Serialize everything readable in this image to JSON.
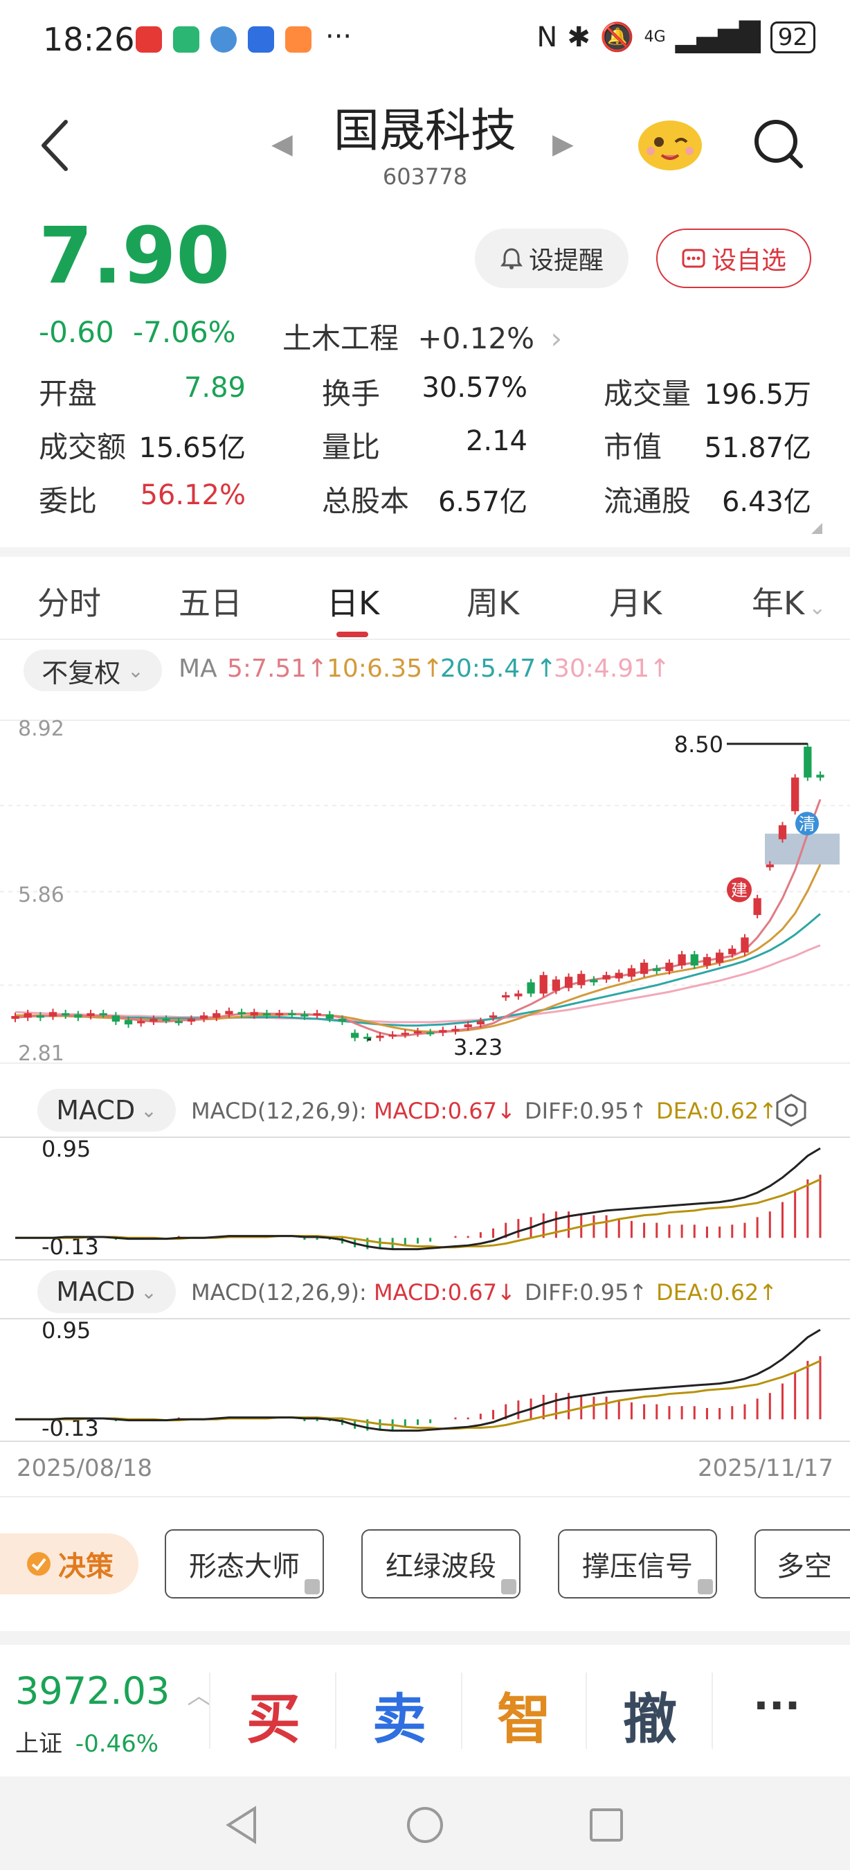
{
  "status_bar": {
    "time": "18:26",
    "network": "4G",
    "battery": "92",
    "icons": [
      "mail-icon",
      "home-icon",
      "weather-icon",
      "app-icon",
      "app-icon-2",
      "bluetooth-icon",
      "mute-icon",
      "signal-icon"
    ]
  },
  "header": {
    "stock_name": "国晟科技",
    "stock_code": "603778"
  },
  "quote": {
    "price": "7.90",
    "change": "-0.60",
    "change_pct": "-7.06%",
    "sector_name": "土木工程",
    "sector_change": "+0.12%",
    "remind_label": "设提醒",
    "favorite_label": "设自选",
    "stats": [
      {
        "label": "开盘",
        "value": "7.89",
        "value_color": "#1aa356"
      },
      {
        "label": "换手",
        "value": "30.57%",
        "value_color": "#222222"
      },
      {
        "label": "成交量",
        "value": "196.5万",
        "value_color": "#222222"
      },
      {
        "label": "成交额",
        "value": "15.65亿",
        "value_color": "#222222"
      },
      {
        "label": "量比",
        "value": "2.14",
        "value_color": "#222222"
      },
      {
        "label": "市值",
        "value": "51.87亿",
        "value_color": "#222222"
      },
      {
        "label": "委比",
        "value": "56.12%",
        "value_color": "#d9363e"
      },
      {
        "label": "总股本",
        "value": "6.57亿",
        "value_color": "#222222"
      },
      {
        "label": "流通股",
        "value": "6.43亿",
        "value_color": "#222222"
      }
    ]
  },
  "tabs": [
    "分时",
    "五日",
    "日K",
    "周K",
    "月K",
    "年K"
  ],
  "active_tab": "日K",
  "kline": {
    "adjust_label": "不复权",
    "ma_label": "MA",
    "ma5": "5:7.51↑",
    "ma10": "10:6.35↑",
    "ma20": "20:5.47↑",
    "ma30": "30:4.91↑",
    "y_top": "8.92",
    "y_mid": "5.86",
    "y_bottom": "2.81",
    "high_label": "8.50",
    "low_label": "3.23",
    "badge_jian": "建",
    "badge_qing": "清"
  },
  "macd_panels": [
    {
      "chip": "MACD",
      "params": "MACD(12,26,9):",
      "macd": "MACD:0.67↓",
      "diff": "DIFF:0.95↑",
      "dea": "DEA:0.62↑",
      "y_top": "0.95",
      "y_bottom": "-0.13"
    },
    {
      "chip": "MACD",
      "params": "MACD(12,26,9):",
      "macd": "MACD:0.67↓",
      "diff": "DIFF:0.95↑",
      "dea": "DEA:0.62↑",
      "y_top": "0.95",
      "y_bottom": "-0.13"
    }
  ],
  "dates": {
    "start": "2025/08/18",
    "end": "2025/11/17"
  },
  "tools": {
    "juece": "决策",
    "items": [
      "形态大师",
      "红绿波段",
      "撑压信号",
      "多空"
    ]
  },
  "bottom_bar": {
    "index_value": "3972.03",
    "index_name": "上证",
    "index_change": "-0.46%",
    "buy": "买",
    "sell": "卖",
    "smart": "智",
    "cancel": "撤",
    "more": "···"
  },
  "colors": {
    "up": "#d9363e",
    "down": "#1aa356",
    "ma5": "#e07b83",
    "ma10": "#d39a3a",
    "ma20": "#2ea6a6",
    "ma30": "#f2a8b8"
  },
  "chart_data": {
    "type": "candlestick",
    "title": "",
    "x_start": "2025/08/18",
    "x_end": "2025/11/17",
    "ylim": [
      2.81,
      8.92
    ],
    "candles": [
      {
        "o": 3.6,
        "c": 3.65
      },
      {
        "o": 3.62,
        "c": 3.7
      },
      {
        "o": 3.66,
        "c": 3.62
      },
      {
        "o": 3.64,
        "c": 3.72
      },
      {
        "o": 3.7,
        "c": 3.66
      },
      {
        "o": 3.68,
        "c": 3.62
      },
      {
        "o": 3.65,
        "c": 3.7
      },
      {
        "o": 3.7,
        "c": 3.68
      },
      {
        "o": 3.66,
        "c": 3.55
      },
      {
        "o": 3.58,
        "c": 3.5
      },
      {
        "o": 3.52,
        "c": 3.56
      },
      {
        "o": 3.55,
        "c": 3.6
      },
      {
        "o": 3.6,
        "c": 3.58
      },
      {
        "o": 3.56,
        "c": 3.54
      },
      {
        "o": 3.55,
        "c": 3.6
      },
      {
        "o": 3.6,
        "c": 3.66
      },
      {
        "o": 3.62,
        "c": 3.7
      },
      {
        "o": 3.68,
        "c": 3.74
      },
      {
        "o": 3.72,
        "c": 3.68
      },
      {
        "o": 3.66,
        "c": 3.72
      },
      {
        "o": 3.7,
        "c": 3.66
      },
      {
        "o": 3.68,
        "c": 3.7
      },
      {
        "o": 3.7,
        "c": 3.68
      },
      {
        "o": 3.68,
        "c": 3.64
      },
      {
        "o": 3.66,
        "c": 3.7
      },
      {
        "o": 3.68,
        "c": 3.6
      },
      {
        "o": 3.6,
        "c": 3.55
      },
      {
        "o": 3.35,
        "c": 3.26
      },
      {
        "o": 3.28,
        "c": 3.25
      },
      {
        "o": 3.26,
        "c": 3.3
      },
      {
        "o": 3.3,
        "c": 3.32
      },
      {
        "o": 3.32,
        "c": 3.35
      },
      {
        "o": 3.34,
        "c": 3.38
      },
      {
        "o": 3.36,
        "c": 3.35
      },
      {
        "o": 3.35,
        "c": 3.4
      },
      {
        "o": 3.38,
        "c": 3.42
      },
      {
        "o": 3.45,
        "c": 3.5
      },
      {
        "o": 3.5,
        "c": 3.56
      },
      {
        "o": 3.62,
        "c": 3.66
      },
      {
        "o": 3.98,
        "c": 4.02
      },
      {
        "o": 4.0,
        "c": 4.05
      },
      {
        "o": 4.25,
        "c": 4.05
      },
      {
        "o": 4.05,
        "c": 4.38
      },
      {
        "o": 4.1,
        "c": 4.3
      },
      {
        "o": 4.15,
        "c": 4.35
      },
      {
        "o": 4.2,
        "c": 4.4
      },
      {
        "o": 4.3,
        "c": 4.25
      },
      {
        "o": 4.3,
        "c": 4.38
      },
      {
        "o": 4.32,
        "c": 4.42
      },
      {
        "o": 4.35,
        "c": 4.5
      },
      {
        "o": 4.4,
        "c": 4.6
      },
      {
        "o": 4.5,
        "c": 4.45
      },
      {
        "o": 4.45,
        "c": 4.6
      },
      {
        "o": 4.55,
        "c": 4.75
      },
      {
        "o": 4.75,
        "c": 4.55
      },
      {
        "o": 4.55,
        "c": 4.7
      },
      {
        "o": 4.6,
        "c": 4.78
      },
      {
        "o": 4.75,
        "c": 4.85
      },
      {
        "o": 4.78,
        "c": 5.05
      },
      {
        "o": 5.45,
        "c": 5.75
      },
      {
        "o": 6.3,
        "c": 6.35
      },
      {
        "o": 6.8,
        "c": 7.05
      },
      {
        "o": 7.3,
        "c": 7.9
      },
      {
        "o": 8.45,
        "c": 7.9
      },
      {
        "o": 7.95,
        "c": 7.9
      }
    ],
    "ma5": [
      3.62,
      3.64,
      3.65,
      3.66,
      3.66,
      3.66,
      3.65,
      3.66,
      3.64,
      3.6,
      3.57,
      3.55,
      3.55,
      3.57,
      3.58,
      3.6,
      3.63,
      3.66,
      3.69,
      3.7,
      3.69,
      3.69,
      3.69,
      3.68,
      3.67,
      3.66,
      3.62,
      3.52,
      3.43,
      3.35,
      3.3,
      3.3,
      3.33,
      3.35,
      3.37,
      3.39,
      3.42,
      3.46,
      3.52,
      3.64,
      3.76,
      3.86,
      3.98,
      4.1,
      4.2,
      4.26,
      4.3,
      4.33,
      4.36,
      4.4,
      4.45,
      4.49,
      4.52,
      4.57,
      4.6,
      4.64,
      4.68,
      4.72,
      4.82,
      5.05,
      5.35,
      5.75,
      6.25,
      6.9,
      7.51
    ],
    "ma10": [
      3.66,
      3.66,
      3.66,
      3.65,
      3.65,
      3.64,
      3.63,
      3.62,
      3.61,
      3.6,
      3.59,
      3.58,
      3.58,
      3.58,
      3.58,
      3.59,
      3.6,
      3.62,
      3.64,
      3.66,
      3.67,
      3.67,
      3.68,
      3.68,
      3.67,
      3.66,
      3.64,
      3.6,
      3.55,
      3.5,
      3.45,
      3.41,
      3.38,
      3.37,
      3.37,
      3.38,
      3.4,
      3.43,
      3.47,
      3.53,
      3.6,
      3.68,
      3.76,
      3.85,
      3.93,
      4.01,
      4.08,
      4.15,
      4.21,
      4.27,
      4.33,
      4.38,
      4.42,
      4.46,
      4.5,
      4.55,
      4.6,
      4.65,
      4.72,
      4.84,
      5.0,
      5.2,
      5.48,
      5.88,
      6.35
    ],
    "ma20": [
      3.66,
      3.66,
      3.65,
      3.65,
      3.65,
      3.64,
      3.64,
      3.63,
      3.63,
      3.62,
      3.62,
      3.61,
      3.61,
      3.61,
      3.61,
      3.61,
      3.62,
      3.62,
      3.63,
      3.63,
      3.63,
      3.63,
      3.62,
      3.61,
      3.6,
      3.58,
      3.56,
      3.54,
      3.52,
      3.5,
      3.49,
      3.48,
      3.48,
      3.49,
      3.5,
      3.52,
      3.54,
      3.57,
      3.6,
      3.64,
      3.68,
      3.72,
      3.76,
      3.8,
      3.85,
      3.9,
      3.95,
      4.0,
      4.05,
      4.1,
      4.15,
      4.2,
      4.26,
      4.32,
      4.38,
      4.44,
      4.5,
      4.56,
      4.63,
      4.72,
      4.82,
      4.95,
      5.1,
      5.28,
      5.47
    ],
    "ma30": [
      3.72,
      3.71,
      3.7,
      3.69,
      3.68,
      3.68,
      3.67,
      3.66,
      3.66,
      3.65,
      3.65,
      3.64,
      3.64,
      3.63,
      3.63,
      3.63,
      3.63,
      3.62,
      3.62,
      3.62,
      3.62,
      3.61,
      3.61,
      3.6,
      3.6,
      3.59,
      3.58,
      3.57,
      3.56,
      3.55,
      3.54,
      3.54,
      3.54,
      3.54,
      3.55,
      3.56,
      3.57,
      3.58,
      3.6,
      3.62,
      3.64,
      3.67,
      3.7,
      3.73,
      3.76,
      3.8,
      3.84,
      3.88,
      3.92,
      3.96,
      4.0,
      4.04,
      4.08,
      4.13,
      4.18,
      4.23,
      4.28,
      4.34,
      4.4,
      4.47,
      4.55,
      4.64,
      4.72,
      4.82,
      4.91
    ],
    "macd_ylim": [
      -0.13,
      0.95
    ],
    "diff": [
      0.0,
      0.0,
      0.0,
      0.0,
      0.01,
      0.01,
      0.01,
      0.01,
      0.0,
      -0.01,
      -0.01,
      -0.01,
      -0.01,
      0.0,
      0.0,
      0.0,
      0.01,
      0.02,
      0.02,
      0.02,
      0.02,
      0.02,
      0.02,
      0.01,
      0.01,
      0.0,
      -0.02,
      -0.06,
      -0.09,
      -0.11,
      -0.12,
      -0.12,
      -0.12,
      -0.11,
      -0.1,
      -0.09,
      -0.08,
      -0.06,
      -0.03,
      0.02,
      0.07,
      0.11,
      0.16,
      0.2,
      0.23,
      0.25,
      0.27,
      0.29,
      0.3,
      0.31,
      0.32,
      0.33,
      0.34,
      0.35,
      0.36,
      0.37,
      0.38,
      0.4,
      0.43,
      0.48,
      0.55,
      0.64,
      0.75,
      0.87,
      0.95
    ],
    "dea": [
      0.0,
      0.0,
      0.0,
      0.0,
      0.0,
      0.0,
      0.01,
      0.01,
      0.01,
      0.0,
      0.0,
      0.0,
      -0.01,
      -0.01,
      0.0,
      0.0,
      0.0,
      0.01,
      0.01,
      0.01,
      0.01,
      0.02,
      0.02,
      0.02,
      0.02,
      0.01,
      0.01,
      -0.01,
      -0.03,
      -0.05,
      -0.06,
      -0.08,
      -0.09,
      -0.09,
      -0.1,
      -0.1,
      -0.09,
      -0.09,
      -0.08,
      -0.06,
      -0.03,
      0.0,
      0.03,
      0.06,
      0.09,
      0.12,
      0.15,
      0.17,
      0.2,
      0.22,
      0.24,
      0.25,
      0.27,
      0.28,
      0.29,
      0.31,
      0.32,
      0.33,
      0.35,
      0.37,
      0.41,
      0.45,
      0.5,
      0.56,
      0.62
    ],
    "macd_hist": [
      0.0,
      0.0,
      0.0,
      0.0,
      0.02,
      0.02,
      0.0,
      0.0,
      -0.02,
      -0.02,
      -0.02,
      -0.02,
      0.0,
      0.02,
      0.0,
      0.0,
      0.02,
      0.02,
      0.02,
      0.02,
      0.02,
      0.0,
      0.0,
      -0.02,
      -0.02,
      -0.02,
      -0.06,
      -0.1,
      -0.12,
      -0.12,
      -0.12,
      -0.08,
      -0.06,
      -0.04,
      0.0,
      0.02,
      0.02,
      0.06,
      0.1,
      0.16,
      0.2,
      0.22,
      0.26,
      0.28,
      0.28,
      0.26,
      0.24,
      0.24,
      0.2,
      0.18,
      0.16,
      0.16,
      0.14,
      0.14,
      0.14,
      0.12,
      0.12,
      0.14,
      0.16,
      0.22,
      0.28,
      0.38,
      0.5,
      0.62,
      0.67
    ]
  }
}
